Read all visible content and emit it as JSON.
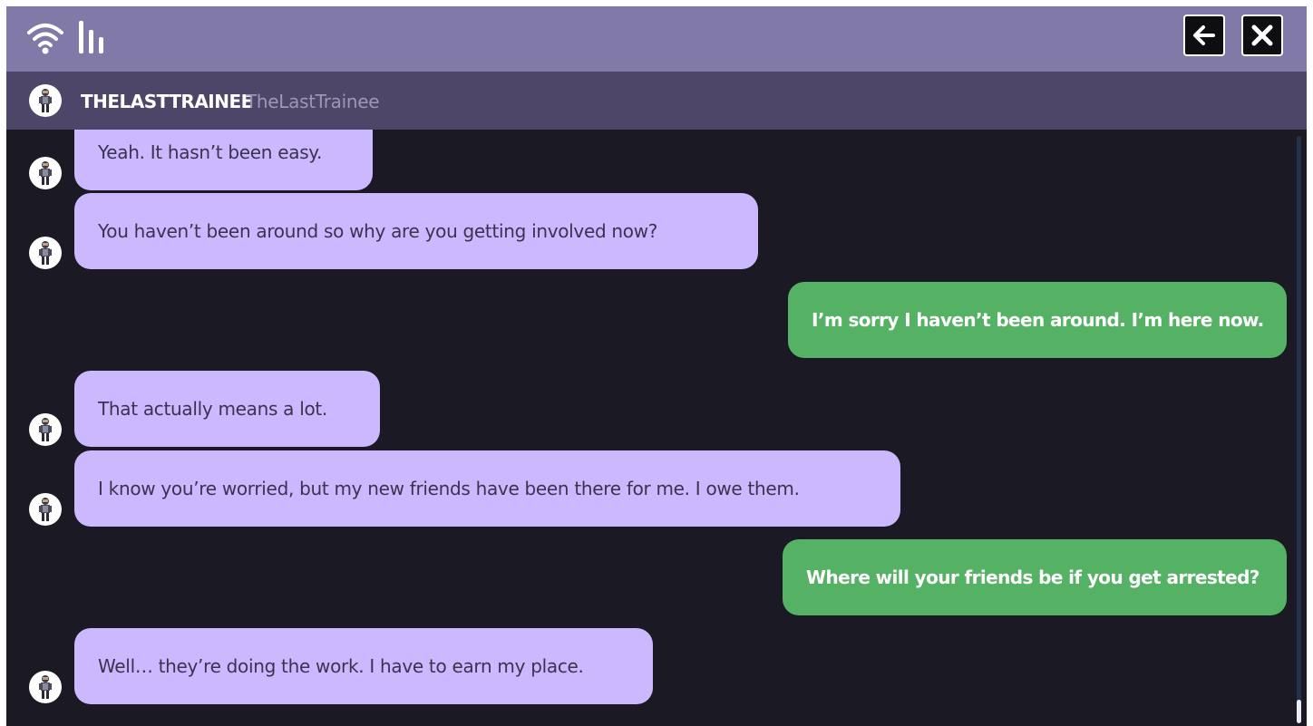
{
  "topbar": {
    "icons": [
      "wifi-icon",
      "signal-bars-icon"
    ],
    "back_icon": "arrow-left-icon",
    "close_icon": "close-icon"
  },
  "contact": {
    "name": "THELASTTRAINEE",
    "handle": "TheLastTrainee",
    "avatar_icon": "character-avatar-icon"
  },
  "messages": [
    {
      "from": "contact",
      "text": "Yeah. It hasn’t been easy."
    },
    {
      "from": "contact",
      "text": "You haven’t been around so why are you getting involved now?"
    },
    {
      "from": "me",
      "text": "I’m sorry I haven’t been around. I’m here now."
    },
    {
      "from": "contact",
      "text": "That actually means a lot."
    },
    {
      "from": "contact",
      "text": "I know you’re worried, but my new friends have been there for me. I owe them."
    },
    {
      "from": "me",
      "text": "Where will your friends be if you get arrested?"
    },
    {
      "from": "contact",
      "text": "Well… they’re doing the work. I have to earn my place."
    }
  ],
  "colors": {
    "topbar": "#8179a8",
    "contactbar": "#4e4669",
    "background": "#1b1a24",
    "incoming_bubble": "#cbb8ff",
    "outgoing_bubble": "#55b265"
  }
}
